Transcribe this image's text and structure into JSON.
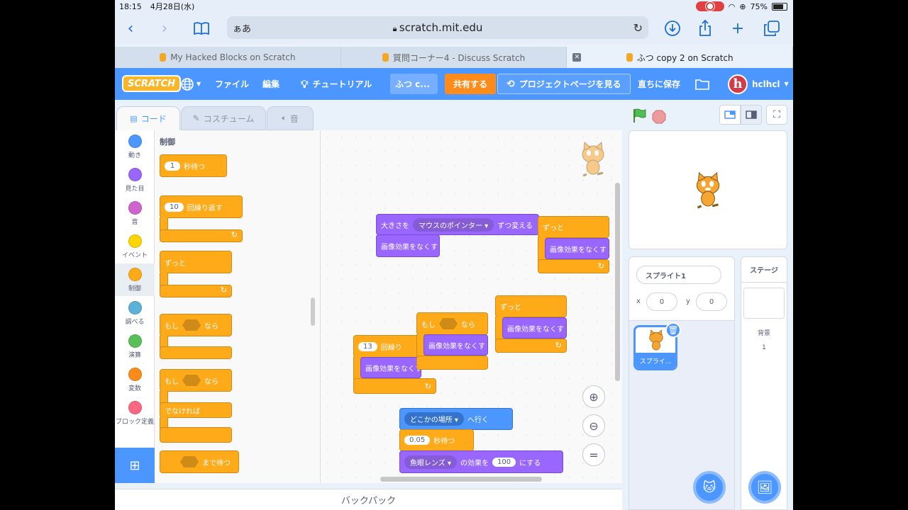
{
  "status": {
    "time": "18:15",
    "date": "4月28日(水)",
    "battery": "75%"
  },
  "browser": {
    "aa": "ぁあ",
    "url": "scratch.mit.edu"
  },
  "tabs": [
    {
      "label": "My Hacked Blocks on Scratch"
    },
    {
      "label": "質問コーナー4 - Discuss Scratch"
    },
    {
      "label": "ふつ copy 2 on Scratch"
    }
  ],
  "menu": {
    "logo": "SCRATCH",
    "file": "ファイル",
    "edit": "編集",
    "tutorials": "チュートリアル",
    "title": "ふつ c...",
    "share": "共有する",
    "project_page": "プロジェクトページを見る",
    "save_now": "直ちに保存",
    "avatar_letter": "h",
    "username": "hclhcl"
  },
  "editor_tabs": {
    "code": "コード",
    "costumes": "コスチューム",
    "sounds": "音"
  },
  "categories": [
    {
      "label": "動き",
      "color": "#4c97ff"
    },
    {
      "label": "見た目",
      "color": "#9966ff"
    },
    {
      "label": "音",
      "color": "#cf63cf"
    },
    {
      "label": "イベント",
      "color": "#ffd500"
    },
    {
      "label": "制御",
      "color": "#ffab19"
    },
    {
      "label": "調べる",
      "color": "#5cb1d6"
    },
    {
      "label": "演算",
      "color": "#59c059"
    },
    {
      "label": "変数",
      "color": "#ff8c1a"
    },
    {
      "label": "ブロック定義",
      "color": "#ff6680"
    }
  ],
  "palette": {
    "heading": "制御",
    "wait_value": "1",
    "wait_text": "秒待つ",
    "repeat_value": "10",
    "repeat_text": "回繰り返す",
    "forever": "ずっと",
    "if_text": "もし",
    "then_text": "なら",
    "else_text": "でなければ",
    "wait_until": "まで待つ"
  },
  "workspace": {
    "size_change": "大きさを",
    "size_menu": "マウスのポインター",
    "size_suffix": "ずつ変える",
    "clear_effects": "画像効果をなくす",
    "forever": "ずっと",
    "if_text": "もし",
    "then_text": "なら",
    "repeat_value": "13",
    "repeat_text": "回繰り",
    "goto_menu": "どこかの場所",
    "goto_suffix": "へ行く",
    "wait_value": "0.05",
    "wait_text": "秒待つ",
    "effect_menu": "魚眼レンズ",
    "effect_middle": "の効果を",
    "effect_value": "100",
    "effect_suffix": "にする"
  },
  "backpack": "バックパック",
  "sprite": {
    "name": "スプライト1",
    "x_label": "x",
    "x": "0",
    "y_label": "y",
    "y": "0",
    "thumb_label": "スプライ..."
  },
  "stage_pane": {
    "title": "ステージ",
    "backdrops_label": "背景",
    "backdrops_count": "1"
  }
}
